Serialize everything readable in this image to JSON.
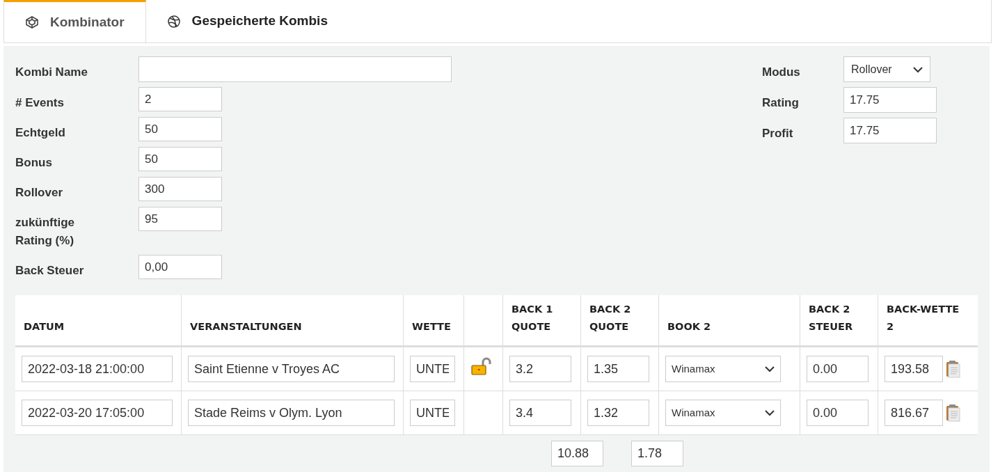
{
  "tabs": [
    {
      "label": "Kombinator",
      "selected": true
    },
    {
      "label": "Gespeicherte Kombis",
      "selected": false
    }
  ],
  "form_left": [
    {
      "label": "Kombi Name",
      "wide": true
    },
    {
      "label": "# Events",
      "value": "2"
    },
    {
      "label": "Echtgeld",
      "value": "50"
    },
    {
      "label": "Bonus",
      "value": "50"
    },
    {
      "label": "Rollover",
      "value": "300"
    },
    {
      "label": "zukünftige Rating (%)",
      "value": "95"
    },
    {
      "label": "Back Steuer",
      "value": "0,00"
    }
  ],
  "form_right": [
    {
      "label": "Modus",
      "kind": "select",
      "value": "Rollover"
    },
    {
      "label": "Rating",
      "kind": "input",
      "value": "17.75"
    },
    {
      "label": "Profit",
      "kind": "input",
      "value": "17.75"
    }
  ],
  "table": {
    "columns": [
      "DATUM",
      "VERANSTALTUNGEN",
      "WETTE",
      "BACK 1 QUOTE",
      "BACK 2 QUOTE",
      "BOOK 2",
      "BACK 2 STEUER",
      "BACK-WETTE 2"
    ],
    "rows": [
      {
        "datum": "2022-03-18 21:00:00",
        "event": "Saint Etienne v Troyes AC",
        "wette": "UNTE",
        "lock_icon": true,
        "back1": "3.2",
        "back2": "1.35",
        "book2": "Winamax",
        "steuer": "0.00",
        "back_wette": "193.58"
      },
      {
        "datum": "2022-03-20 17:05:00",
        "event": "Stade Reims v Olym. Lyon",
        "wette": "UNTE",
        "lock_icon": false,
        "back1": "3.4",
        "back2": "1.32",
        "book2": "Winamax",
        "steuer": "0.00",
        "back_wette": "816.67"
      }
    ]
  },
  "totals": [
    "10.88",
    "1.78"
  ]
}
